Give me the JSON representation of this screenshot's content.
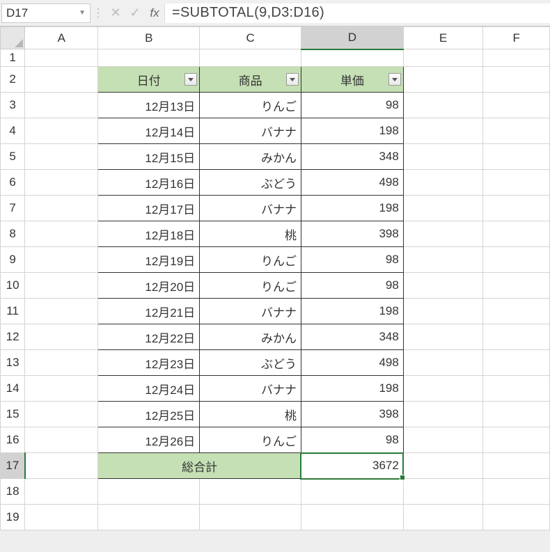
{
  "name_box": "D17",
  "formula": "=SUBTOTAL(9,D3:D16)",
  "col_headers": [
    "A",
    "B",
    "C",
    "D",
    "E",
    "F"
  ],
  "row_headers": [
    "1",
    "2",
    "3",
    "4",
    "5",
    "6",
    "7",
    "8",
    "9",
    "10",
    "11",
    "12",
    "13",
    "14",
    "15",
    "16",
    "17",
    "18",
    "19"
  ],
  "table": {
    "headers": [
      "日付",
      "商品",
      "単価"
    ],
    "rows": [
      {
        "date": "12月13日",
        "product": "りんご",
        "price": "98"
      },
      {
        "date": "12月14日",
        "product": "バナナ",
        "price": "198"
      },
      {
        "date": "12月15日",
        "product": "みかん",
        "price": "348"
      },
      {
        "date": "12月16日",
        "product": "ぶどう",
        "price": "498"
      },
      {
        "date": "12月17日",
        "product": "バナナ",
        "price": "198"
      },
      {
        "date": "12月18日",
        "product": "桃",
        "price": "398"
      },
      {
        "date": "12月19日",
        "product": "りんご",
        "price": "98"
      },
      {
        "date": "12月20日",
        "product": "りんご",
        "price": "98"
      },
      {
        "date": "12月21日",
        "product": "バナナ",
        "price": "198"
      },
      {
        "date": "12月22日",
        "product": "みかん",
        "price": "348"
      },
      {
        "date": "12月23日",
        "product": "ぶどう",
        "price": "498"
      },
      {
        "date": "12月24日",
        "product": "バナナ",
        "price": "198"
      },
      {
        "date": "12月25日",
        "product": "桃",
        "price": "398"
      },
      {
        "date": "12月26日",
        "product": "りんご",
        "price": "98"
      }
    ],
    "total_label": "総合計",
    "total_value": "3672"
  }
}
